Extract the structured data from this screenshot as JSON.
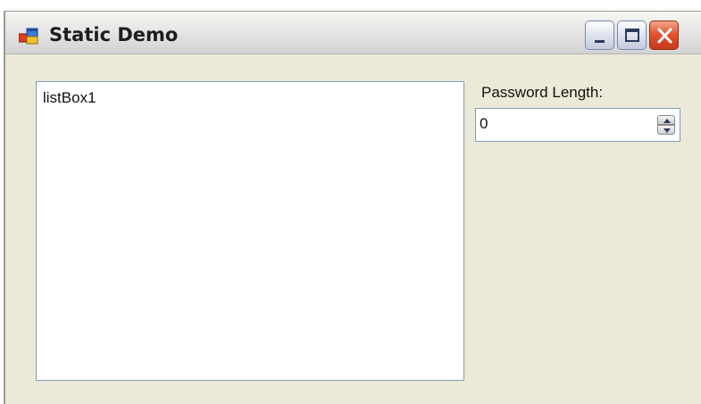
{
  "window": {
    "title": "Static Demo",
    "icons": {
      "app": "app-window-icon",
      "minimize": "minimize-icon",
      "maximize": "maximize-icon",
      "close": "close-icon"
    }
  },
  "listbox": {
    "items": [
      "listBox1"
    ]
  },
  "password_length": {
    "label": "Password Length:",
    "value": "0",
    "icons": {
      "up": "arrow-up-icon",
      "down": "arrow-down-icon"
    }
  },
  "colors": {
    "window_background": "#ece9d8",
    "close_button": "#e2552f",
    "field_border": "#7f9db9"
  }
}
